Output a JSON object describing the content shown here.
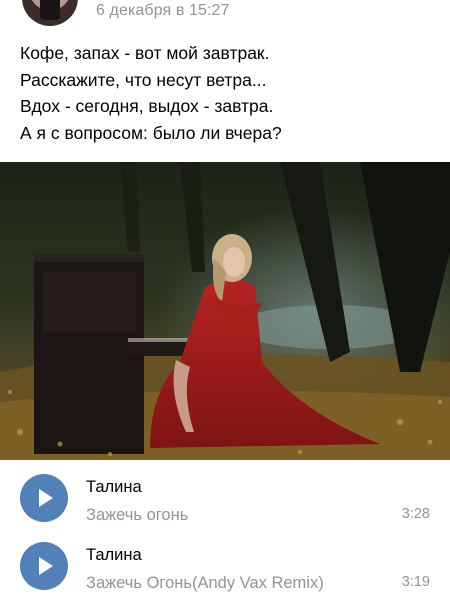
{
  "post": {
    "date": "6 декабря в 15:27",
    "text_lines": [
      "Кофе, запах - вот мой завтрак.",
      "Расскажите, что несут ветра...",
      "Вдох - сегодня, выдох - завтра.",
      "А я с вопросом: было ли вчера?"
    ]
  },
  "audio": [
    {
      "artist": "Талина",
      "title": "Зажечь огонь",
      "duration": "3:28",
      "icon": "play-icon"
    },
    {
      "artist": "Талина",
      "title": "Зажечь Огонь(Andy Vax Remix)",
      "duration": "3:19",
      "icon": "play-icon"
    }
  ],
  "colors": {
    "accent": "#5181b8",
    "secondary_text": "#8f959c",
    "dress": "#a11c1a"
  }
}
